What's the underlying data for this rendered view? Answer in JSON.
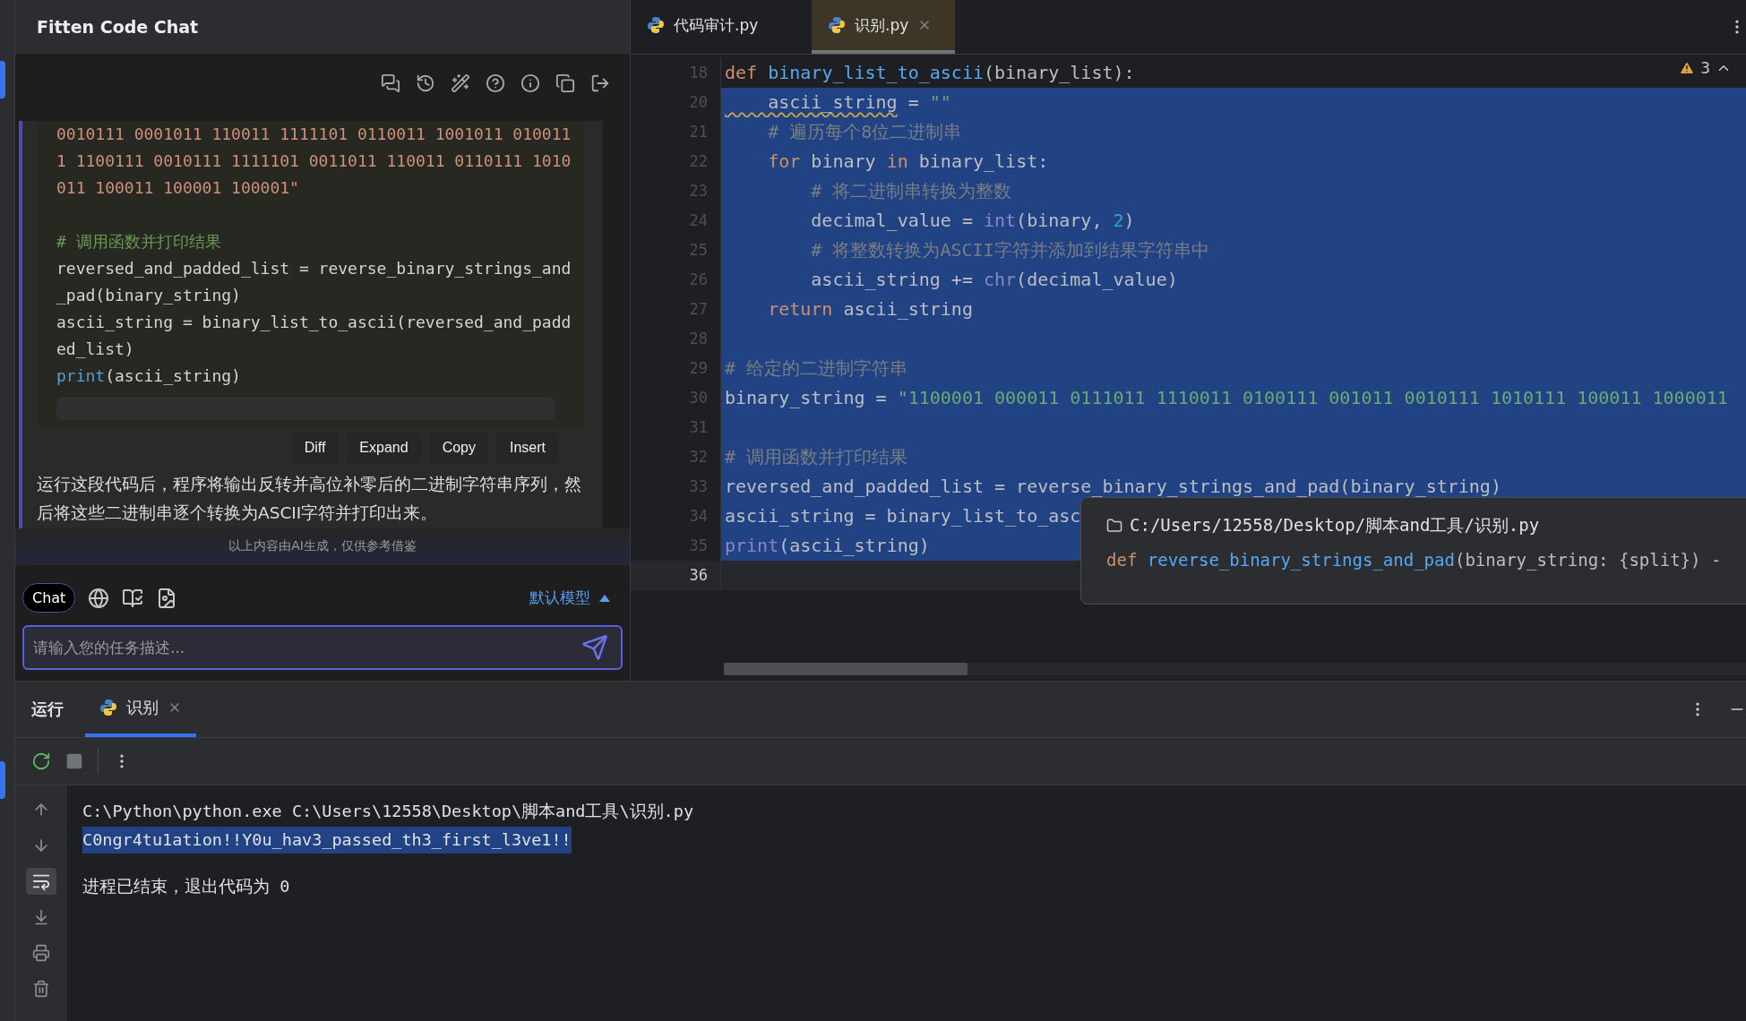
{
  "chat": {
    "title": "Fitten Code Chat",
    "code_sections": [
      {
        "lines": [
          {
            "tokens": [
              {
                "kind": "str",
                "text": "0010111 0001011 110011 1111101 0110011 1001011 010011"
              }
            ]
          },
          {
            "tokens": [
              {
                "kind": "str",
                "text": "1 1100111 0010111 1111101 0011011 110011 0110111 1010"
              }
            ]
          },
          {
            "tokens": [
              {
                "kind": "str",
                "text": "011 100011 100001 100001\""
              }
            ]
          }
        ]
      },
      {
        "lines": [
          {
            "tokens": [
              {
                "kind": "cm",
                "text": "# 调用函数并打印结果"
              }
            ]
          },
          {
            "tokens": [
              {
                "kind": "p",
                "text": "reversed_and_padded_list = reverse_binary_strings_and"
              }
            ]
          },
          {
            "tokens": [
              {
                "kind": "p",
                "text": "_pad(binary_string)"
              }
            ]
          },
          {
            "tokens": [
              {
                "kind": "p",
                "text": "ascii_string = binary_list_to_ascii(reversed_and_padd"
              }
            ]
          },
          {
            "tokens": [
              {
                "kind": "p",
                "text": "ed_list)"
              }
            ]
          },
          {
            "tokens": [
              {
                "kind": "bi",
                "text": "print"
              },
              {
                "kind": "p",
                "text": "(ascii_string)"
              }
            ]
          }
        ]
      }
    ],
    "actions": [
      "Diff",
      "Expand",
      "Copy",
      "Insert"
    ],
    "message": "运行这段代码后，程序将输出反转并高位补零后的二进制字符串序列，然后将这些二进制串逐个转换为ASCII字符并打印出来。",
    "disclaimer": "以上内容由AI生成，仅供参考借鉴",
    "mode": "Chat",
    "model": "默认模型",
    "input": {
      "placeholder": "请输入您的任务描述..."
    }
  },
  "editor": {
    "tabs": [
      {
        "label": "代码审计.py",
        "selected": false
      },
      {
        "label": "识别.py",
        "selected": true
      }
    ],
    "warnings": "3",
    "lines": [
      {
        "number": "18",
        "selected": false,
        "current": false,
        "tokens": [
          {
            "kind": "kw",
            "text": "def "
          },
          {
            "kind": "fn",
            "text": "binary_list_to_ascii"
          },
          {
            "kind": "p",
            "text": "(binary_list):"
          }
        ]
      },
      {
        "number": "20",
        "selected": true,
        "current": false,
        "tokens": [
          {
            "kind": "warn",
            "text": "    ascii_string"
          },
          {
            "kind": "p",
            "text": " = "
          },
          {
            "kind": "str",
            "text": "\"\""
          }
        ]
      },
      {
        "number": "21",
        "selected": true,
        "current": false,
        "tokens": [
          {
            "kind": "cm",
            "text": "    # 遍历每个8位二进制串"
          }
        ]
      },
      {
        "number": "22",
        "selected": true,
        "current": false,
        "tokens": [
          {
            "kind": "kw",
            "text": "    for"
          },
          {
            "kind": "p",
            "text": " binary "
          },
          {
            "kind": "kw",
            "text": "in"
          },
          {
            "kind": "p",
            "text": " binary_list:"
          }
        ]
      },
      {
        "number": "23",
        "selected": true,
        "current": false,
        "tokens": [
          {
            "kind": "cm",
            "text": "        # 将二进制串转换为整数"
          }
        ]
      },
      {
        "number": "24",
        "selected": true,
        "current": false,
        "tokens": [
          {
            "kind": "p",
            "text": "        decimal_value = "
          },
          {
            "kind": "bi",
            "text": "int"
          },
          {
            "kind": "p",
            "text": "(binary, "
          },
          {
            "kind": "num",
            "text": "2"
          },
          {
            "kind": "p",
            "text": ")"
          }
        ]
      },
      {
        "number": "25",
        "selected": true,
        "current": false,
        "tokens": [
          {
            "kind": "cm",
            "text": "        # 将整数转换为ASCII字符并添加到结果字符串中"
          }
        ]
      },
      {
        "number": "26",
        "selected": true,
        "current": false,
        "tokens": [
          {
            "kind": "p",
            "text": "        ascii_string += "
          },
          {
            "kind": "bi",
            "text": "chr"
          },
          {
            "kind": "p",
            "text": "(decimal_value)"
          }
        ]
      },
      {
        "number": "27",
        "selected": true,
        "current": false,
        "tokens": [
          {
            "kind": "kw",
            "text": "    return"
          },
          {
            "kind": "p",
            "text": " ascii_string"
          }
        ]
      },
      {
        "number": "28",
        "selected": true,
        "current": false
      },
      {
        "number": "29",
        "selected": true,
        "current": false,
        "tokens": [
          {
            "kind": "cm",
            "text": "# 给定的二进制字符串"
          }
        ]
      },
      {
        "number": "30",
        "selected": true,
        "current": false,
        "tokens": [
          {
            "kind": "p",
            "text": "binary_string = "
          },
          {
            "kind": "str",
            "text": "\"1100001 000011 0111011 1110011 0100111 001011 0010111 1010111 100011 1000011"
          }
        ]
      },
      {
        "number": "31",
        "selected": true,
        "current": false
      },
      {
        "number": "32",
        "selected": true,
        "current": false,
        "tokens": [
          {
            "kind": "cm",
            "text": "# 调用函数并打印结果"
          }
        ]
      },
      {
        "number": "33",
        "selected": true,
        "current": false,
        "tokens": [
          {
            "kind": "p",
            "text": "reversed_and_padded_list = reverse_binary_strings_and_pad(binary_string)"
          }
        ]
      },
      {
        "number": "34",
        "selected": true,
        "current": false,
        "tokens": [
          {
            "kind": "p",
            "text": "ascii_string = binary_list_to_asc"
          }
        ]
      },
      {
        "number": "35",
        "selected": true,
        "current": false,
        "tokens": [
          {
            "kind": "bi",
            "text": "print"
          },
          {
            "kind": "p",
            "text": "(ascii_string)"
          }
        ]
      },
      {
        "number": "36",
        "selected": false,
        "current": true
      }
    ],
    "tooltip": {
      "path": "C:/Users/12558/Desktop/脚本and工具/识别.py",
      "signature": [
        {
          "kind": "kw",
          "text": "def "
        },
        {
          "kind": "fn",
          "text": "reverse_binary_strings_and_pad"
        },
        {
          "kind": "p",
          "text": "(binary_string: {split}) -"
        }
      ]
    }
  },
  "run_panel": {
    "title": "运行",
    "tabs": [
      {
        "label": "识别",
        "selected": true
      }
    ],
    "console": [
      {
        "kind": "cmd",
        "selected": false,
        "text": "C:\\Python\\python.exe C:\\Users\\12558\\Desktop\\脚本and工具\\识别.py"
      },
      {
        "kind": "output",
        "selected": true,
        "text": "C0ngr4tu1ation!!Y0u_hav3_passed_th3_first_l3ve1!!"
      },
      {
        "kind": "exit",
        "selected": false,
        "text": "进程已结束，退出代码为 0"
      }
    ]
  }
}
